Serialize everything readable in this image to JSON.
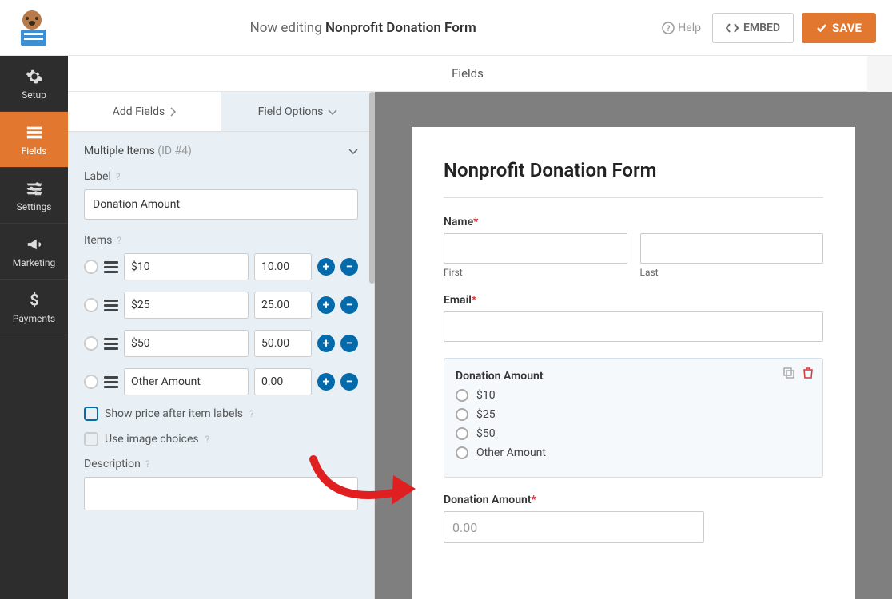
{
  "header": {
    "editing_prefix": "Now editing ",
    "form_name": "Nonprofit Donation Form",
    "help": "Help",
    "embed": "EMBED",
    "save": "SAVE"
  },
  "nav": {
    "setup": "Setup",
    "fields": "Fields",
    "settings": "Settings",
    "marketing": "Marketing",
    "payments": "Payments"
  },
  "panel": {
    "fields_header": "Fields",
    "tab_add": "Add Fields",
    "tab_options": "Field Options",
    "section_name": "Multiple Items",
    "section_id": "(ID #4)",
    "label_label": "Label",
    "label_value": "Donation Amount",
    "items_label": "Items",
    "items": [
      {
        "label": "$10",
        "price": "10.00"
      },
      {
        "label": "$25",
        "price": "25.00"
      },
      {
        "label": "$50",
        "price": "50.00"
      },
      {
        "label": "Other Amount",
        "price": "0.00"
      }
    ],
    "show_price": "Show price after item labels",
    "use_images": "Use image choices",
    "description_label": "Description"
  },
  "preview": {
    "title": "Nonprofit Donation Form",
    "name_label": "Name",
    "first": "First",
    "last": "Last",
    "email_label": "Email",
    "donation_label": "Donation Amount",
    "options": [
      "$10",
      "$25",
      "$50",
      "Other Amount"
    ],
    "amount_label": "Donation Amount",
    "amount_placeholder": "0.00"
  }
}
